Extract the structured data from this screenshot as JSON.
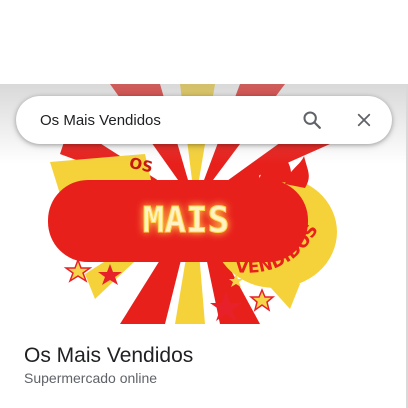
{
  "search": {
    "value": "Os Mais Vendidos",
    "search_icon": "search-icon",
    "close_icon": "close-icon"
  },
  "hero": {
    "logo_text_top": "OS",
    "logo_text_main": "MAIS",
    "logo_text_bottom": "VENDIDOS",
    "colors": {
      "red": "#e8201c",
      "yellow": "#f5d23a",
      "neon_glow": "#ffd34a",
      "star_red": "#e8202a",
      "star_yellow": "#f7d54b"
    }
  },
  "place": {
    "title": "Os Mais Vendidos",
    "category": "Supermercado online"
  }
}
